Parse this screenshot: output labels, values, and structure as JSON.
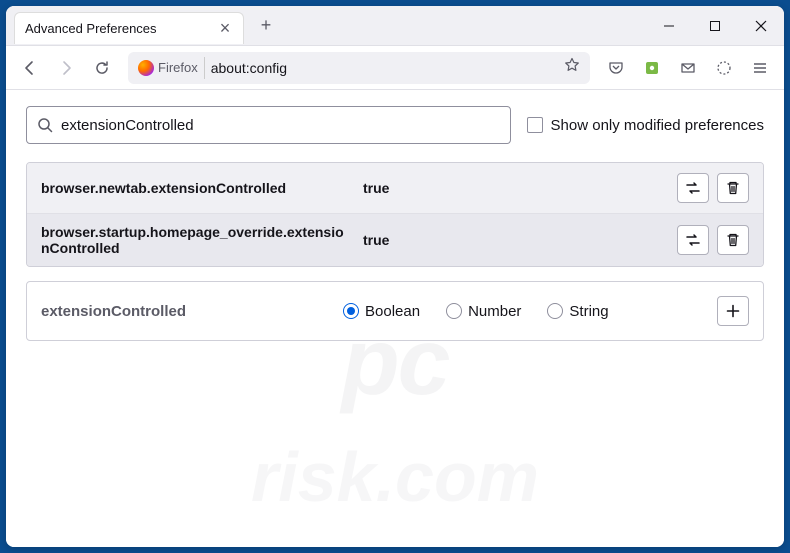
{
  "tab": {
    "title": "Advanced Preferences"
  },
  "urlbar": {
    "brand": "Firefox",
    "url": "about:config"
  },
  "search": {
    "value": "extensionControlled",
    "checkbox_label": "Show only modified preferences"
  },
  "prefs": [
    {
      "name": "browser.newtab.extensionControlled",
      "value": "true"
    },
    {
      "name": "browser.startup.homepage_override.extensionControlled",
      "value": "true"
    }
  ],
  "add": {
    "name": "extensionControlled",
    "types": [
      "Boolean",
      "Number",
      "String"
    ],
    "selected": "Boolean"
  },
  "watermark": "pc",
  "watermark2": "risk.com"
}
